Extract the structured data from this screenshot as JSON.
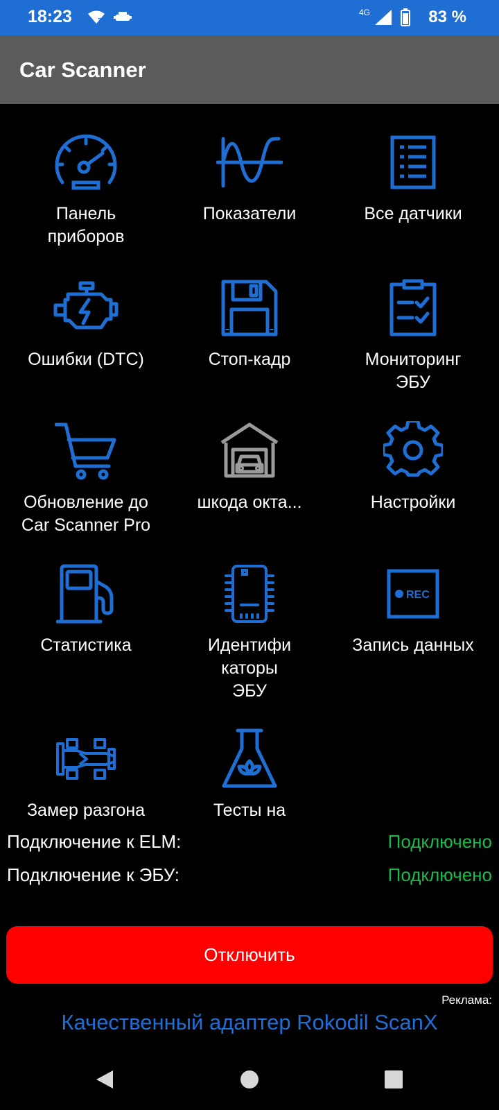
{
  "status_bar": {
    "time": "18:23",
    "network": "4G",
    "battery": "83 %",
    "icons": [
      "wifi-question-icon",
      "car-icon",
      "network-4g-icon",
      "signal-icon",
      "battery-icon"
    ]
  },
  "app": {
    "title": "Car Scanner"
  },
  "colors": {
    "accent": "#1f6ed4",
    "toolbar": "#5b5b5b",
    "connected": "#1db94a",
    "danger": "#ff0000",
    "garage_icon": "#9a9a9a"
  },
  "menu": [
    {
      "label": "Панель\nприборов",
      "icon": "dashboard-gauge-icon"
    },
    {
      "label": "Показатели",
      "icon": "sine-wave-icon"
    },
    {
      "label": "Все датчики",
      "icon": "list-document-icon"
    },
    {
      "label": "Ошибки (DTC)",
      "icon": "engine-check-icon"
    },
    {
      "label": "Стоп-кадр",
      "icon": "floppy-disk-icon"
    },
    {
      "label": "Мониторинг\nЭБУ",
      "icon": "clipboard-check-icon"
    },
    {
      "label": "Обновление до\nCar Scanner Pro",
      "icon": "shopping-cart-icon"
    },
    {
      "label": "шкода окта...",
      "icon": "garage-car-icon"
    },
    {
      "label": "Настройки",
      "icon": "gear-icon"
    },
    {
      "label": "Статистика",
      "icon": "fuel-pump-icon"
    },
    {
      "label": "Идентифи\nкаторы\nЭБУ",
      "icon": "ecu-chip-icon"
    },
    {
      "label": "Запись данных",
      "icon": "rec-icon"
    },
    {
      "label": "Замер разгона",
      "icon": "race-car-icon"
    },
    {
      "label": "Тесты на",
      "icon": "flask-leaf-icon"
    }
  ],
  "connection": {
    "elm_label": "Подключение к ELM:",
    "elm_value": "Подключено",
    "ecu_label": "Подключение к ЭБУ:",
    "ecu_value": "Подключено"
  },
  "disconnect_label": "Отключить",
  "ad": {
    "label": "Реклама:",
    "text": "Качественный адаптер Rokodil ScanX"
  },
  "nav": [
    "back-icon",
    "home-icon",
    "recents-icon"
  ],
  "rec_text": "REC"
}
